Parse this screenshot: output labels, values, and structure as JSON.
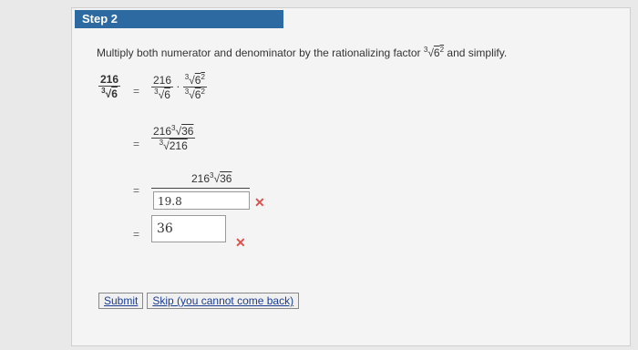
{
  "step_title": "Step 2",
  "instruction": {
    "text_before": "Multiply both numerator and denominator by the rationalizing factor",
    "root_index": "3",
    "radicand_base": "6",
    "radicand_exp": "2",
    "text_after": "and simplify."
  },
  "eq1": {
    "lhs_num": "216",
    "lhs_den_index": "3",
    "lhs_den_radicand": "6",
    "rhs1_num": "216",
    "rhs1_den_index": "3",
    "rhs1_den_radicand": "6",
    "rhs2_num_index": "3",
    "rhs2_num_base": "6",
    "rhs2_num_exp": "2",
    "rhs2_den_index": "3",
    "rhs2_den_base": "6",
    "rhs2_den_exp": "2",
    "equals": "="
  },
  "eq2": {
    "num_coef": "216",
    "num_index": "3",
    "num_radicand": "36",
    "den_index": "3",
    "den_radicand": "216",
    "equals": "="
  },
  "eq3": {
    "num_coef": "216",
    "num_index": "3",
    "num_radicand": "36",
    "answer": "19.8",
    "equals": "="
  },
  "eq4": {
    "answer": "36",
    "equals": "="
  },
  "wrong_symbol": "✕",
  "buttons": {
    "submit": "Submit",
    "skip": "Skip (you cannot come back)"
  },
  "colors": {
    "header": "#2c6aa1",
    "wrong": "#d9534f"
  }
}
